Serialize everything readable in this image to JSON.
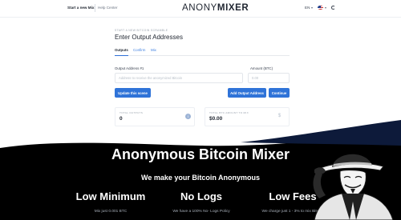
{
  "header": {
    "nav": {
      "start": "Start a new Mix!",
      "help": "Help Center"
    },
    "logo": {
      "light": "ANONY",
      "bold": "MIXER"
    },
    "language": "EN",
    "icons": {
      "flag": "us-flag-icon",
      "theme": "theme-toggle-icon",
      "chevron": "▾"
    }
  },
  "form": {
    "kicker": "Start a new Bitcoin Scramble",
    "title": "Enter Output Addresses",
    "tabs": [
      "Outputs",
      "Confirm",
      "Mix"
    ],
    "address_label": "Output Address #1",
    "address_placeholder": "Address to receive the anonymized Bitcoin",
    "amount_label": "Amount (BTC)",
    "amount_placeholder": "0.00",
    "buttons": {
      "update": "Update this scene",
      "add": "Add Output Address",
      "continue": "Continue"
    }
  },
  "stats": {
    "outputs": {
      "label": "Total outputs",
      "value": "0",
      "icon": "info-icon"
    },
    "sent": {
      "label": "Total BTC amount to mix",
      "value": "$0.00",
      "icon": "dollar-icon"
    }
  },
  "hero": {
    "title": "Anonymous Bitcoin Mixer",
    "subtitle": "We make your Bitcoin Anonymous",
    "features": [
      {
        "title": "Low Minimum",
        "desc": "Mix just 0.001 BTC"
      },
      {
        "title": "No Logs",
        "desc": "We have a 100% No- Logs Policy"
      },
      {
        "title": "Low Fees",
        "desc": "We charge just 1 - 3% to mix Bitcoin"
      }
    ]
  },
  "colors": {
    "accent": "#2f73d8",
    "hero_bg": "#000000",
    "navy": "#0d1a3a"
  }
}
